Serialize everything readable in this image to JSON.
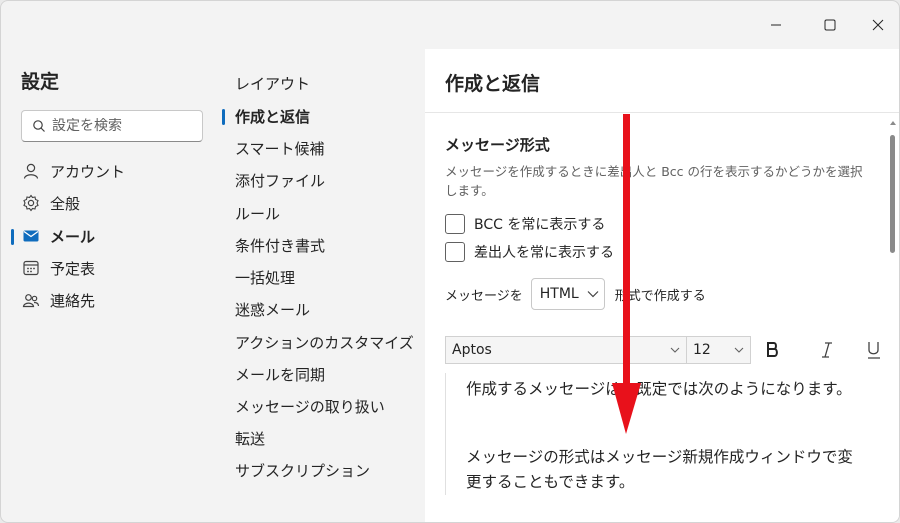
{
  "settings": {
    "title": "設定",
    "search_placeholder": "設定を検索",
    "nav": [
      {
        "label": "アカウント",
        "icon": "person-icon"
      },
      {
        "label": "全般",
        "icon": "gear-icon"
      },
      {
        "label": "メール",
        "icon": "mail-icon",
        "active": true
      },
      {
        "label": "予定表",
        "icon": "calendar-icon"
      },
      {
        "label": "連絡先",
        "icon": "people-icon"
      }
    ]
  },
  "mail_sections": [
    {
      "label": "レイアウト"
    },
    {
      "label": "作成と返信",
      "active": true
    },
    {
      "label": "スマート候補"
    },
    {
      "label": "添付ファイル"
    },
    {
      "label": "ルール"
    },
    {
      "label": "条件付き書式"
    },
    {
      "label": "一括処理"
    },
    {
      "label": "迷惑メール"
    },
    {
      "label": "アクションのカスタマイズ"
    },
    {
      "label": "メールを同期"
    },
    {
      "label": "メッセージの取り扱い"
    },
    {
      "label": "転送"
    },
    {
      "label": "サブスクリプション"
    }
  ],
  "panel": {
    "title": "作成と返信",
    "section_title": "メッセージ形式",
    "section_desc": "メッセージを作成するときに差出人と Bcc の行を表示するかどうかを選択します。",
    "checkboxes": [
      {
        "label": "BCC を常に表示する",
        "checked": false
      },
      {
        "label": "差出人を常に表示する",
        "checked": false
      }
    ],
    "compose_prefix": "メッセージを",
    "compose_format": "HTML",
    "compose_suffix": "形式で作成する",
    "font": "Aptos",
    "font_size": "12",
    "preview_line1": "作成するメッセージは、既定では次のようになります。",
    "preview_line2": "メッセージの形式はメッセージ新規作成ウィンドウで変更することもできます。"
  },
  "colors": {
    "accent": "#0f6cbd",
    "arrow": "#e8111b"
  }
}
